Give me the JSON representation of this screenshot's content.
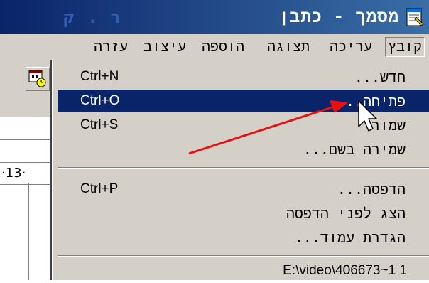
{
  "window": {
    "title": "מסמך - כתבן",
    "title_faint": "ר . ק"
  },
  "menubar": {
    "items": [
      {
        "label": "קובץ",
        "active": true
      },
      {
        "label": "עריכה"
      },
      {
        "label": "תצוגה"
      },
      {
        "label": "הוספה"
      },
      {
        "label": "עיצוב"
      },
      {
        "label": "עזרה"
      }
    ]
  },
  "ruler": {
    "text": "·13·"
  },
  "file_menu": {
    "items": [
      {
        "label": "חדש...",
        "shortcut": "Ctrl+N"
      },
      {
        "label": "פתיחה...",
        "shortcut": "Ctrl+O",
        "selected": true
      },
      {
        "label": "שמור",
        "shortcut": "Ctrl+S"
      },
      {
        "label": "שמירה בשם...",
        "shortcut": ""
      },
      {
        "label": "הדפסה...",
        "shortcut": "Ctrl+P"
      },
      {
        "label": "הצג לפני הדפסה",
        "shortcut": ""
      },
      {
        "label": "הגדרת עמוד...",
        "shortcut": ""
      }
    ],
    "recent_file": "E:\\video\\406673~1 1"
  },
  "colors": {
    "titlebar": "#0a246a",
    "highlight": "#0a246a",
    "menu_bg": "#d4d0c8",
    "annotation_arrow": "#e81010"
  }
}
